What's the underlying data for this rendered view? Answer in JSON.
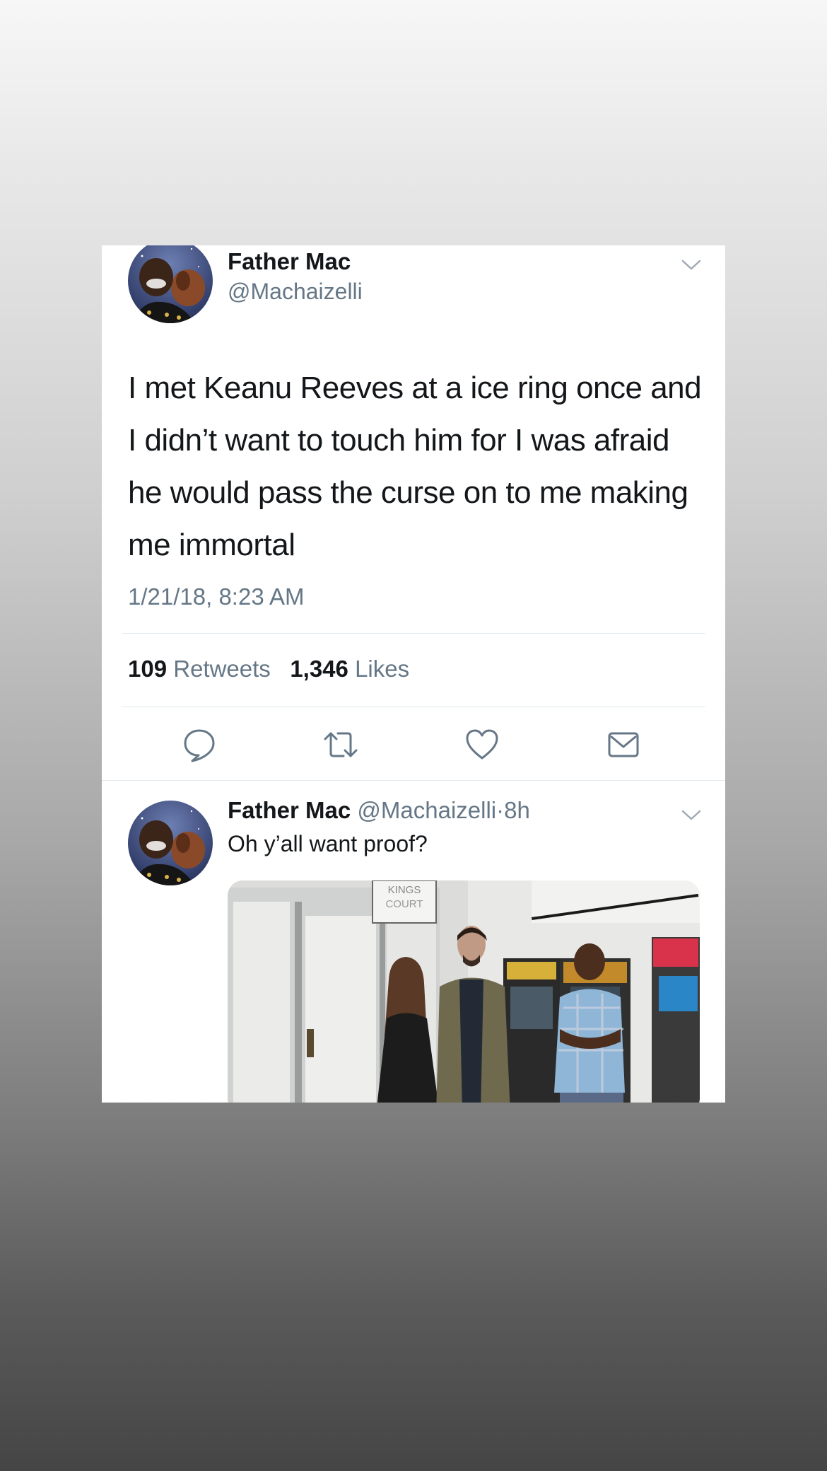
{
  "main_tweet": {
    "display_name": "Father Mac",
    "handle": "@Machaizelli",
    "text": "I met Keanu Reeves at a ice ring once and I didn’t want to touch him for I was afraid he would pass the curse on to me making me immortal",
    "timestamp": "1/21/18, 8:23 AM",
    "retweets_count": "109",
    "retweets_label": "Retweets",
    "likes_count": "1,346",
    "likes_label": "Likes"
  },
  "actions": {
    "reply_icon": "speech-bubble-icon",
    "retweet_icon": "retweet-icon",
    "like_icon": "heart-icon",
    "share_icon": "envelope-icon"
  },
  "reply_tweet": {
    "display_name": "Father Mac",
    "handle": "@Machaizelli",
    "separator": "·",
    "time_ago": "8h",
    "text": "Oh y’all want proof?",
    "photo_sign_text": "KINGS COURT"
  },
  "colors": {
    "text_primary": "#14171a",
    "text_secondary": "#657786",
    "divider": "#e1e8ed",
    "card_bg": "#ffffff"
  }
}
